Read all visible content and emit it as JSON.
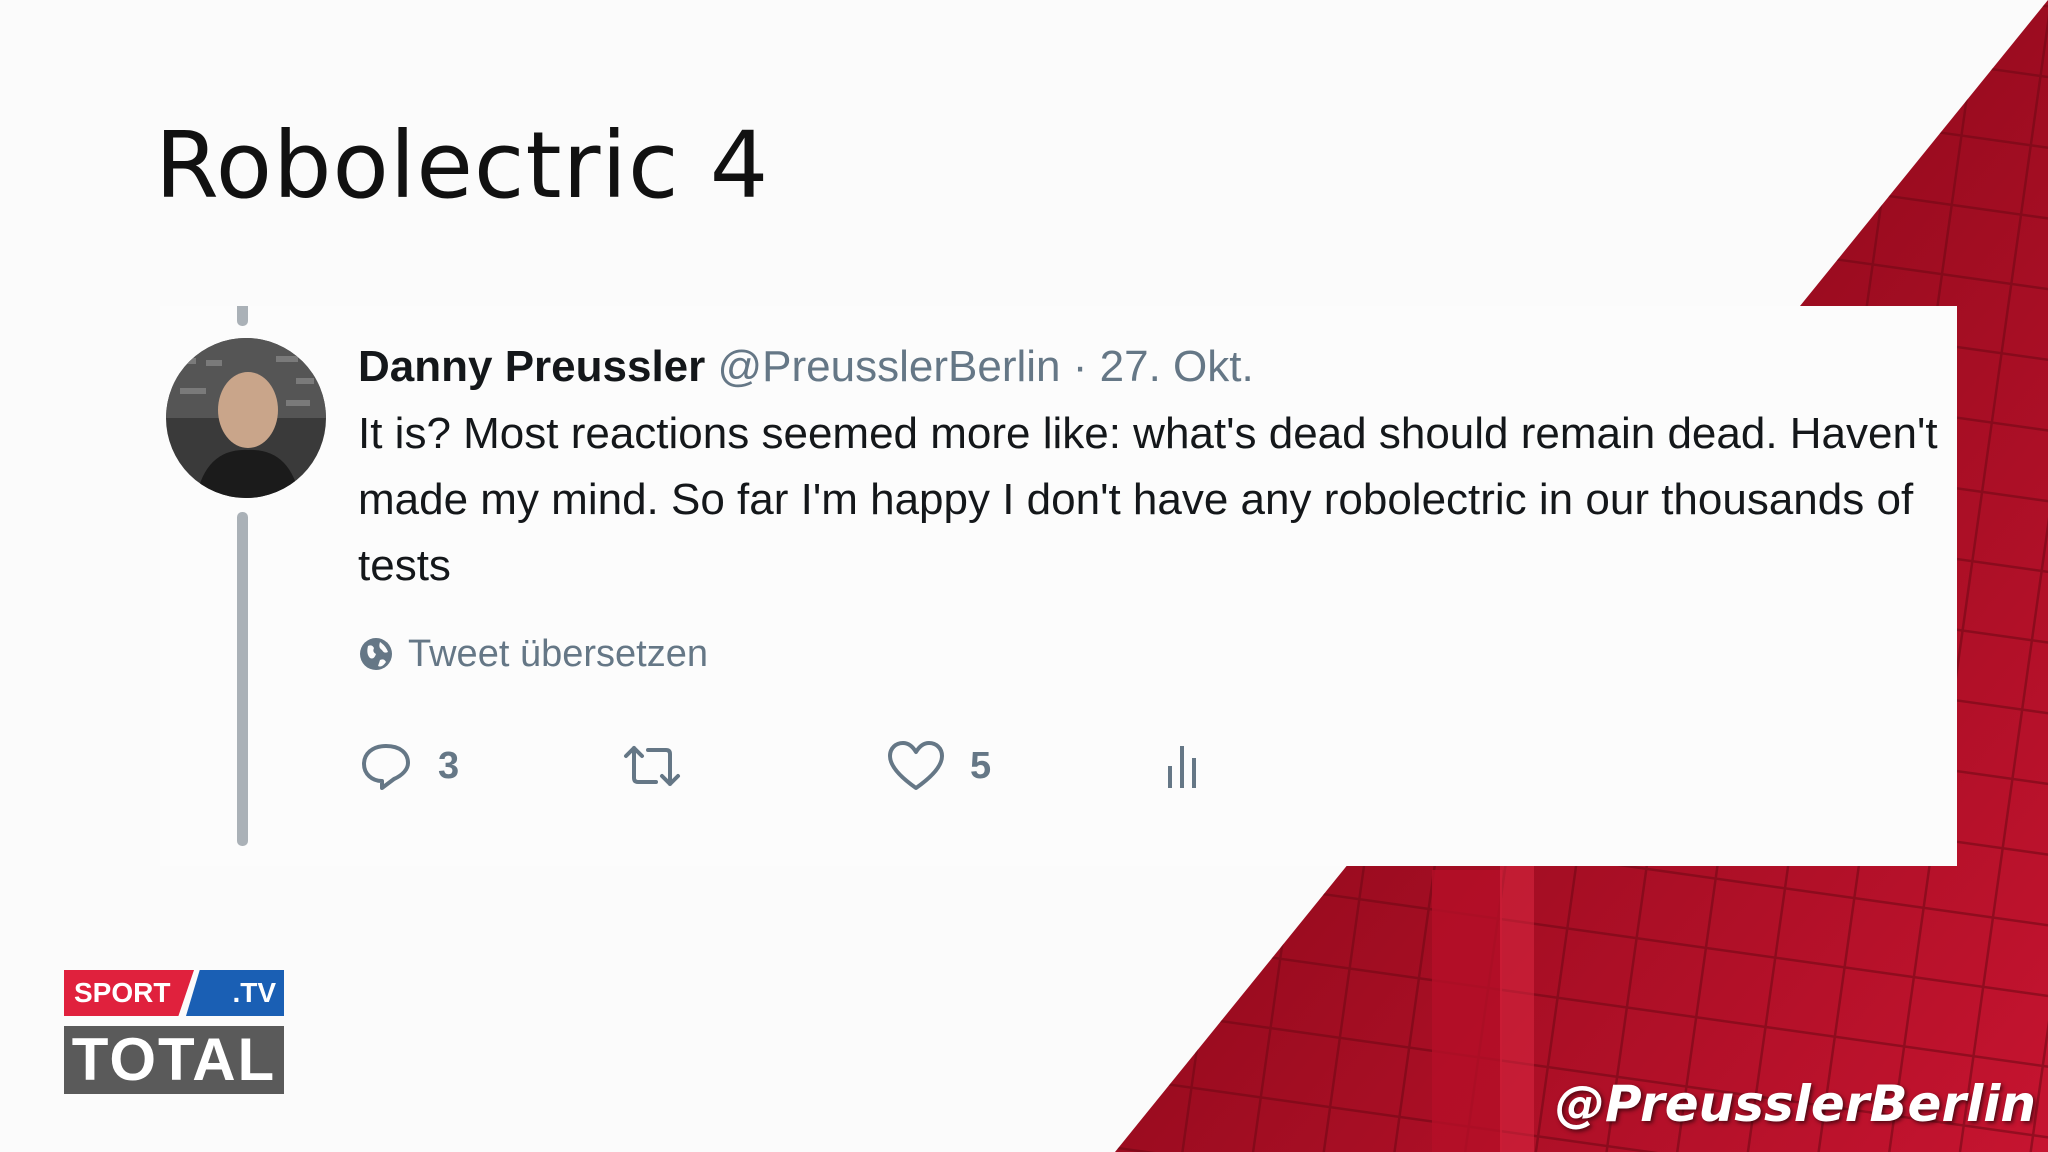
{
  "slide": {
    "title": "Robolectric 4"
  },
  "tweet": {
    "author_name": "Danny Preussler",
    "author_handle": "@PreusslerBerlin",
    "separator": "·",
    "date": "27. Okt.",
    "text": "It is? Most reactions seemed more like: what's dead should remain dead. Haven't made my mind. So far I'm happy I don't have any robolectric in our thousands of tests",
    "translate_label": "Tweet übersetzen",
    "actions": {
      "reply_count": "3",
      "retweet_count": "",
      "like_count": "5"
    }
  },
  "logo": {
    "sport": "SPORT",
    "tv": ".TV",
    "total": "TOTAL"
  },
  "watermark": "@PreusslerBerlin",
  "colors": {
    "accent_red": "#c4122f",
    "text_dark": "#14171a",
    "text_muted": "#657786"
  },
  "icons": [
    "reply-icon",
    "retweet-icon",
    "like-icon",
    "analytics-icon",
    "globe-icon"
  ]
}
